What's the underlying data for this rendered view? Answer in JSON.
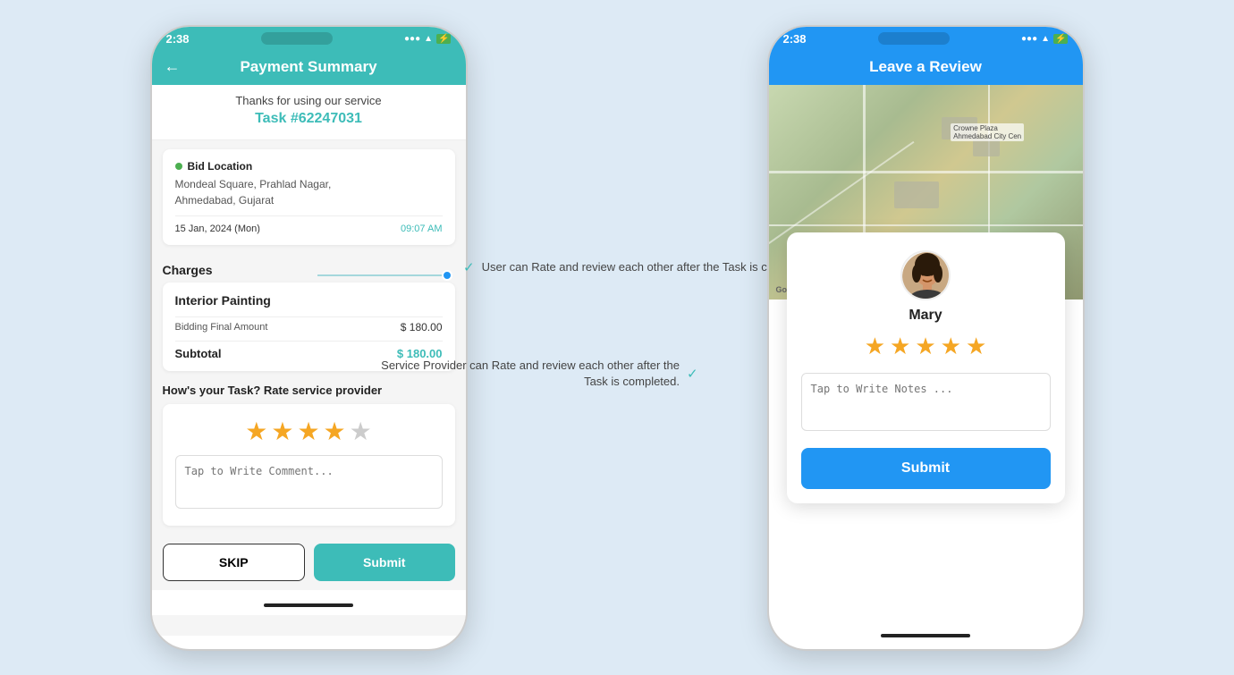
{
  "background": "#ddeaf5",
  "left_phone": {
    "status_bar": {
      "time": "2:38",
      "icons": "▲ ◆ ▶"
    },
    "header": {
      "title": "Payment Summary",
      "back_label": "←"
    },
    "thanks": {
      "text": "Thanks for using our service",
      "task_number": "Task #62247031"
    },
    "location": {
      "label": "Bid Location",
      "address_line1": "Mondeal Square, Prahlad Nagar,",
      "address_line2": "Ahmedabad, Gujarat",
      "date": "15 Jan, 2024 (Mon)",
      "time": "09:07 AM"
    },
    "charges": {
      "title": "Charges",
      "service_name": "Interior Painting",
      "bidding_label": "Bidding Final Amount",
      "bidding_amount": "$ 180.00",
      "subtotal_label": "Subtotal",
      "subtotal_amount": "$ 180.00"
    },
    "rating": {
      "title": "How's your Task? Rate service provider",
      "stars": [
        true,
        true,
        true,
        true,
        false
      ],
      "comment_placeholder": "Tap to Write Comment..."
    },
    "buttons": {
      "skip": "SKIP",
      "submit": "Submit"
    }
  },
  "right_phone": {
    "status_bar": {
      "time": "2:38",
      "icons": "▲ ◆ ▶"
    },
    "header": {
      "title": "Leave a Review"
    },
    "reviewer": {
      "name": "Mary",
      "stars": [
        true,
        true,
        true,
        true,
        true
      ]
    },
    "notes_placeholder": "Tap to Write Notes ...",
    "submit_label": "Submit",
    "google_label": "Google"
  },
  "annotations": {
    "top": {
      "text": "User can Rate and review each other after the Task is completed.",
      "check_icon": "✓"
    },
    "bottom": {
      "text": "Service Provider can Rate and review each other after the Task is completed.",
      "check_icon": "✓"
    }
  }
}
